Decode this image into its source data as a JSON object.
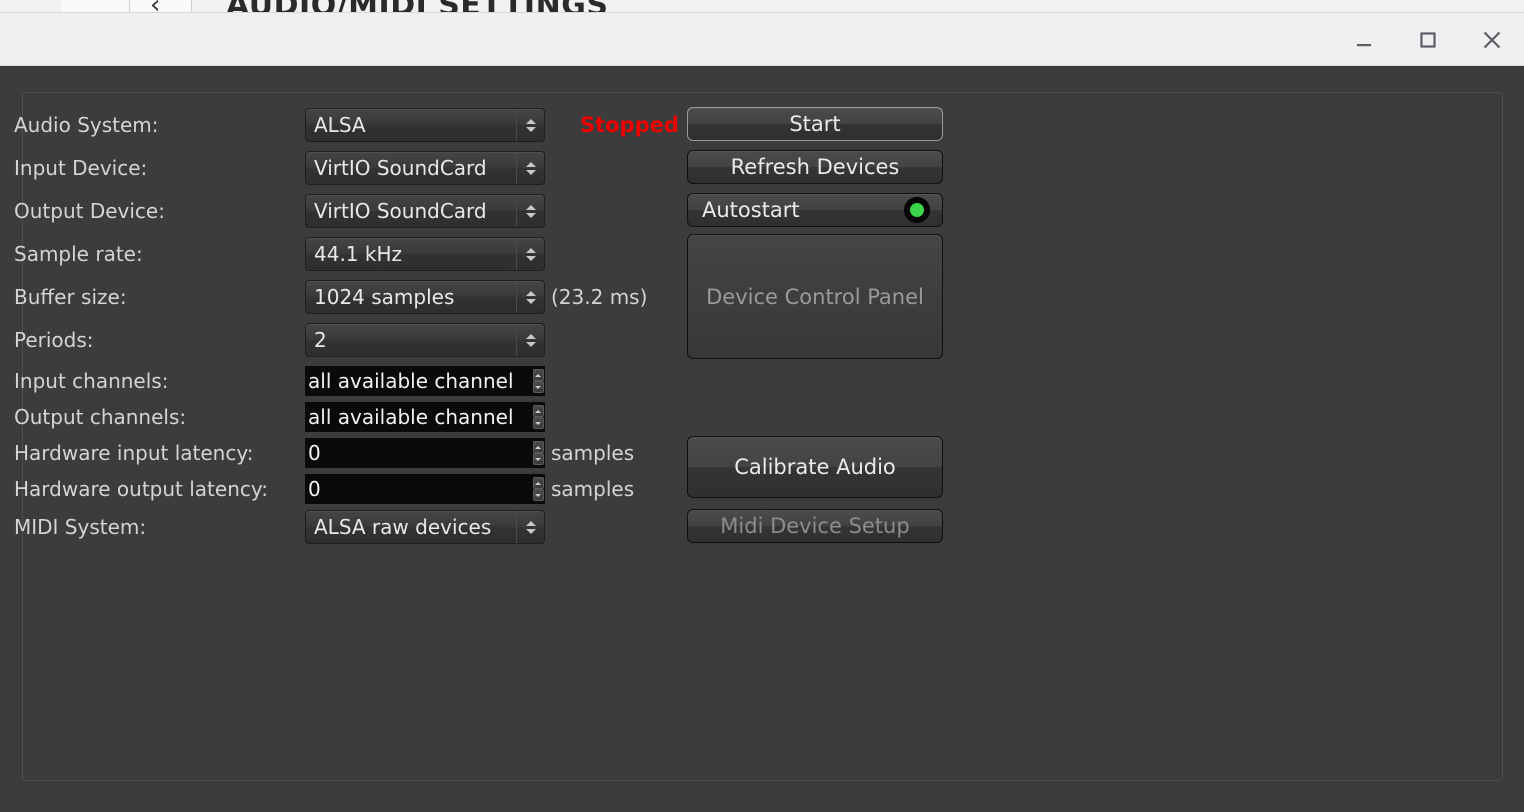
{
  "background_window": {
    "title": "AUDIO/MIDI SETTINGS",
    "back_arrow": "‹"
  },
  "titlebar": {
    "minimize_label": "minimize",
    "maximize_label": "maximize",
    "close_label": "close"
  },
  "colors": {
    "panel_bg": "#3c3c3c",
    "titlebar_bg": "#f0f0f0",
    "status_stopped": "#ee0000",
    "led_on": "#3bd44a",
    "text": "#d4d4d4",
    "disabled_text": "#8c8c8c"
  },
  "settings": {
    "rows": [
      {
        "label": "Audio System:",
        "control": "combo",
        "value": "ALSA"
      },
      {
        "label": "Input Device:",
        "control": "combo",
        "value": "VirtIO SoundCard"
      },
      {
        "label": "Output Device:",
        "control": "combo",
        "value": "VirtIO SoundCard"
      },
      {
        "label": "Sample rate:",
        "control": "combo",
        "value": "44.1 kHz"
      },
      {
        "label": "Buffer size:",
        "control": "combo",
        "value": "1024 samples",
        "suffix": "(23.2 ms)"
      },
      {
        "label": "Periods:",
        "control": "combo",
        "value": "2"
      },
      {
        "label": "Input channels:",
        "control": "spin",
        "value": "all available channel"
      },
      {
        "label": "Output channels:",
        "control": "spin",
        "value": "all available channel"
      },
      {
        "label": "Hardware input latency:",
        "control": "spin",
        "value": "0",
        "suffix": "samples"
      },
      {
        "label": "Hardware output latency:",
        "control": "spin",
        "value": "0",
        "suffix": "samples"
      },
      {
        "label": "MIDI System:",
        "control": "combo",
        "value": "ALSA raw devices"
      }
    ]
  },
  "status": {
    "label": "Stopped"
  },
  "actions": {
    "start": "Start",
    "refresh_devices": "Refresh Devices",
    "autostart": "Autostart",
    "device_control_panel": "Device Control Panel",
    "calibrate_audio": "Calibrate Audio",
    "midi_device_setup": "Midi Device Setup"
  }
}
